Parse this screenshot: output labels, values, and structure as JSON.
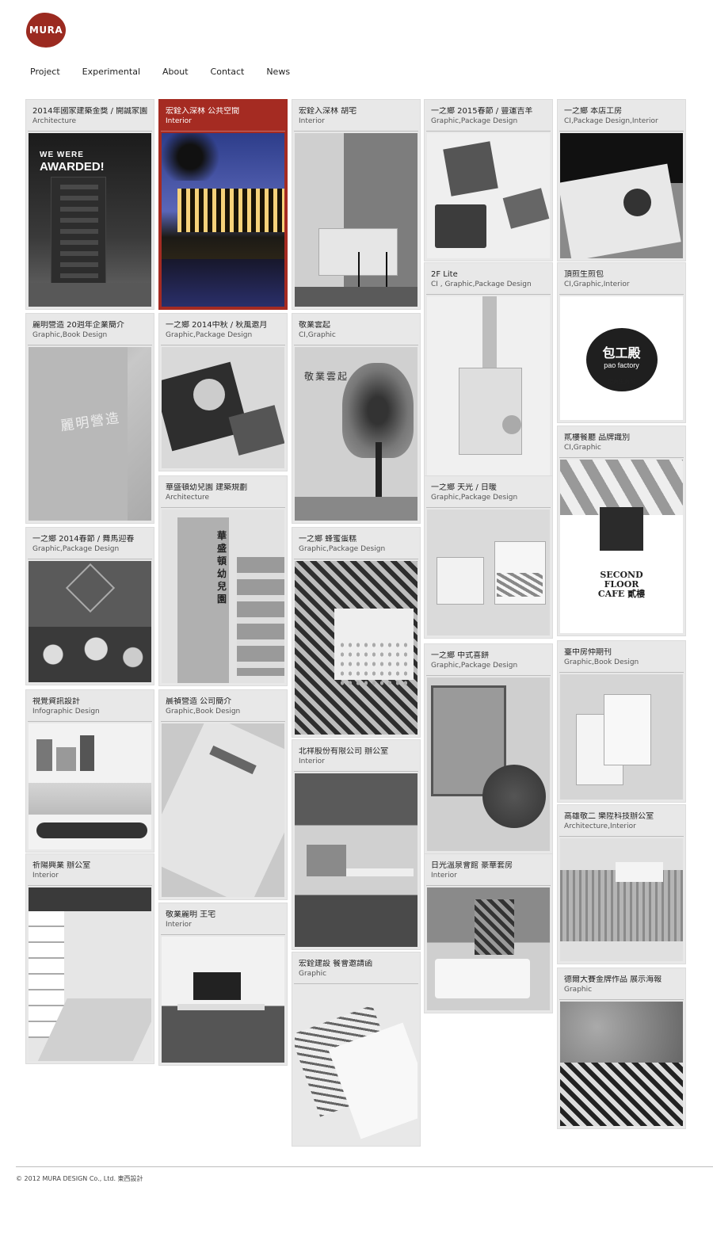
{
  "logo": {
    "text": "MURA"
  },
  "nav": [
    "Project",
    "Experimental",
    "About",
    "Contact",
    "News"
  ],
  "cards": [
    {
      "title": "2014年國家建築金獎 / 開誠家園",
      "cat": "Architecture",
      "img": "tower",
      "overlay1": "WE WERE",
      "overlay2": "AWARDED!"
    },
    {
      "title": "宏銓入深林 公共空間",
      "cat": "Interior",
      "img": "night",
      "active": true
    },
    {
      "title": "宏銓入深林 胡宅",
      "cat": "Interior",
      "img": "kitchen"
    },
    {
      "title": "一之鄉 2015春節 / 豐運吉羊",
      "cat": "Graphic,Package Design",
      "img": "boxes"
    },
    {
      "title": "一之鄉 本店工房",
      "cat": "CI,Package Design,Interior",
      "img": "shopfront"
    },
    {
      "title": "麗明營造 20週年企業簡介",
      "cat": "Graphic,Book Design",
      "img": "book",
      "overlay1": "麗明營造"
    },
    {
      "title": "一之鄉 2014中秋 / 秋風邀月",
      "cat": "Graphic,Package Design",
      "img": "pattern"
    },
    {
      "title": "敬業雲起",
      "cat": "CI,Graphic",
      "img": "tree",
      "overlay1": "敬業雲起"
    },
    {
      "title": "2F Lite",
      "cat": "CI , Graphic,Package Design",
      "img": "hand"
    },
    {
      "title": "頂煎生煎包",
      "cat": "CI,Graphic,Interior",
      "img": "paologo",
      "overlay1": "包工殿",
      "overlay2": "pao factory",
      "overlay3": "頂煎生煎包"
    },
    {
      "title": "華盛頓幼兒園 建築規劃",
      "cat": "Architecture",
      "img": "school",
      "overlay1": "華盛頓幼兒園"
    },
    {
      "title": "貳樓餐廳 品牌識別",
      "cat": "CI,Graphic",
      "img": "secondfloor",
      "overlay1": "SECOND",
      "overlay2": "FLOOR",
      "overlay3": "CAFE 貳樓"
    },
    {
      "title": "一之鄉 2014春節 / 舞馬迎春",
      "cat": "Graphic,Package Design",
      "img": "horse"
    },
    {
      "title": "一之鄉 蜂蜜蛋糕",
      "cat": "Graphic,Package Design",
      "img": "collage"
    },
    {
      "title": "一之鄉 天光 / 日暖",
      "cat": "Graphic,Package Design",
      "img": "packs"
    },
    {
      "title": "視覺資訊設計",
      "cat": "Infographic Design",
      "img": "city"
    },
    {
      "title": "晨禎營造 公司簡介",
      "cat": "Graphic,Book Design",
      "img": "folder"
    },
    {
      "title": "一之鄉 中式喜餅",
      "cat": "Graphic,Package Design",
      "img": "giftbox"
    },
    {
      "title": "臺中房仲期刊",
      "cat": "Graphic,Book Design",
      "img": "magazine"
    },
    {
      "title": "北祥股份有限公司 辦公室",
      "cat": "Interior",
      "img": "office"
    },
    {
      "title": "高雄敬二 樂陞科技辦公室",
      "cat": "Architecture,Interior",
      "img": "model"
    },
    {
      "title": "祈陽興業 辦公室",
      "cat": "Interior",
      "img": "meeting"
    },
    {
      "title": "日光溫泉會館 豪華套房",
      "cat": "Interior",
      "img": "bedroom"
    },
    {
      "title": "敬業麗明 王宅",
      "cat": "Interior",
      "img": "livingroom"
    },
    {
      "title": "宏銓建設 餐會邀請函",
      "cat": "Graphic",
      "img": "invite"
    },
    {
      "title": "德爾大賽金牌作品 展示海報",
      "cat": "Graphic",
      "img": "poster"
    }
  ],
  "footer": "© 2012 MURA DESIGN Co., Ltd. 東西設計"
}
